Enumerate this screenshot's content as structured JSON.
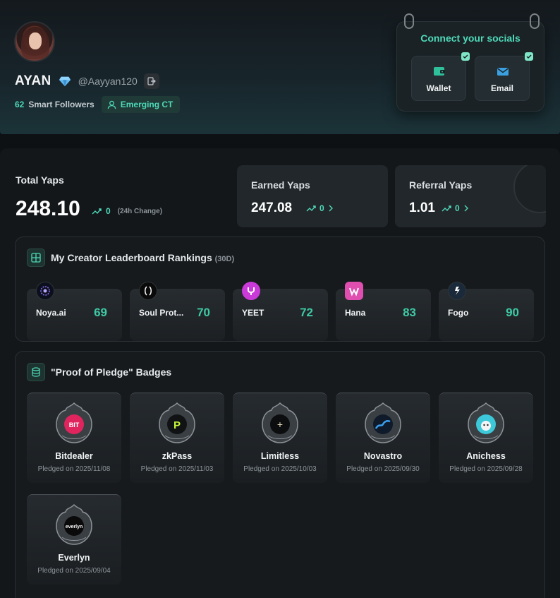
{
  "profile": {
    "name": "AYAN",
    "handle": "@Aayyan120",
    "smart_followers_count": "62",
    "smart_followers_label": "Smart Followers",
    "tier_badge": "Emerging CT"
  },
  "socials": {
    "title": "Connect your socials",
    "wallet_label": "Wallet",
    "email_label": "Email"
  },
  "yaps": {
    "total_label": "Total Yaps",
    "total_value": "248.10",
    "total_change": "0",
    "total_change_note": "(24h Change)",
    "earned_label": "Earned Yaps",
    "earned_value": "247.08",
    "earned_change": "0",
    "referral_label": "Referral Yaps",
    "referral_value": "1.01",
    "referral_change": "0"
  },
  "leaderboard": {
    "title": "My Creator Leaderboard Rankings",
    "period": "(30D)",
    "items": [
      {
        "name": "Noya.ai",
        "rank": "69"
      },
      {
        "name": "Soul Prot...",
        "rank": "70"
      },
      {
        "name": "YEET",
        "rank": "72"
      },
      {
        "name": "Hana",
        "rank": "83"
      },
      {
        "name": "Fogo",
        "rank": "90"
      }
    ]
  },
  "badges": {
    "title": "\"Proof of Pledge\" Badges",
    "items": [
      {
        "name": "Bitdealer",
        "date": "Pledged on 2025/11/08",
        "logo_text": "BIT"
      },
      {
        "name": "zkPass",
        "date": "Pledged on 2025/11/03",
        "logo_text": "P"
      },
      {
        "name": "Limitless",
        "date": "Pledged on 2025/10/03",
        "logo_text": "+"
      },
      {
        "name": "Novastro",
        "date": "Pledged on 2025/09/30",
        "logo_text": ""
      },
      {
        "name": "Anichess",
        "date": "Pledged on 2025/09/28",
        "logo_text": ""
      },
      {
        "name": "Everlyn",
        "date": "Pledged on 2025/09/04",
        "logo_text": "everlyn"
      }
    ]
  },
  "colors": {
    "accent": "#4fd9b8",
    "background": "#0e1114",
    "card": "#22272b"
  }
}
